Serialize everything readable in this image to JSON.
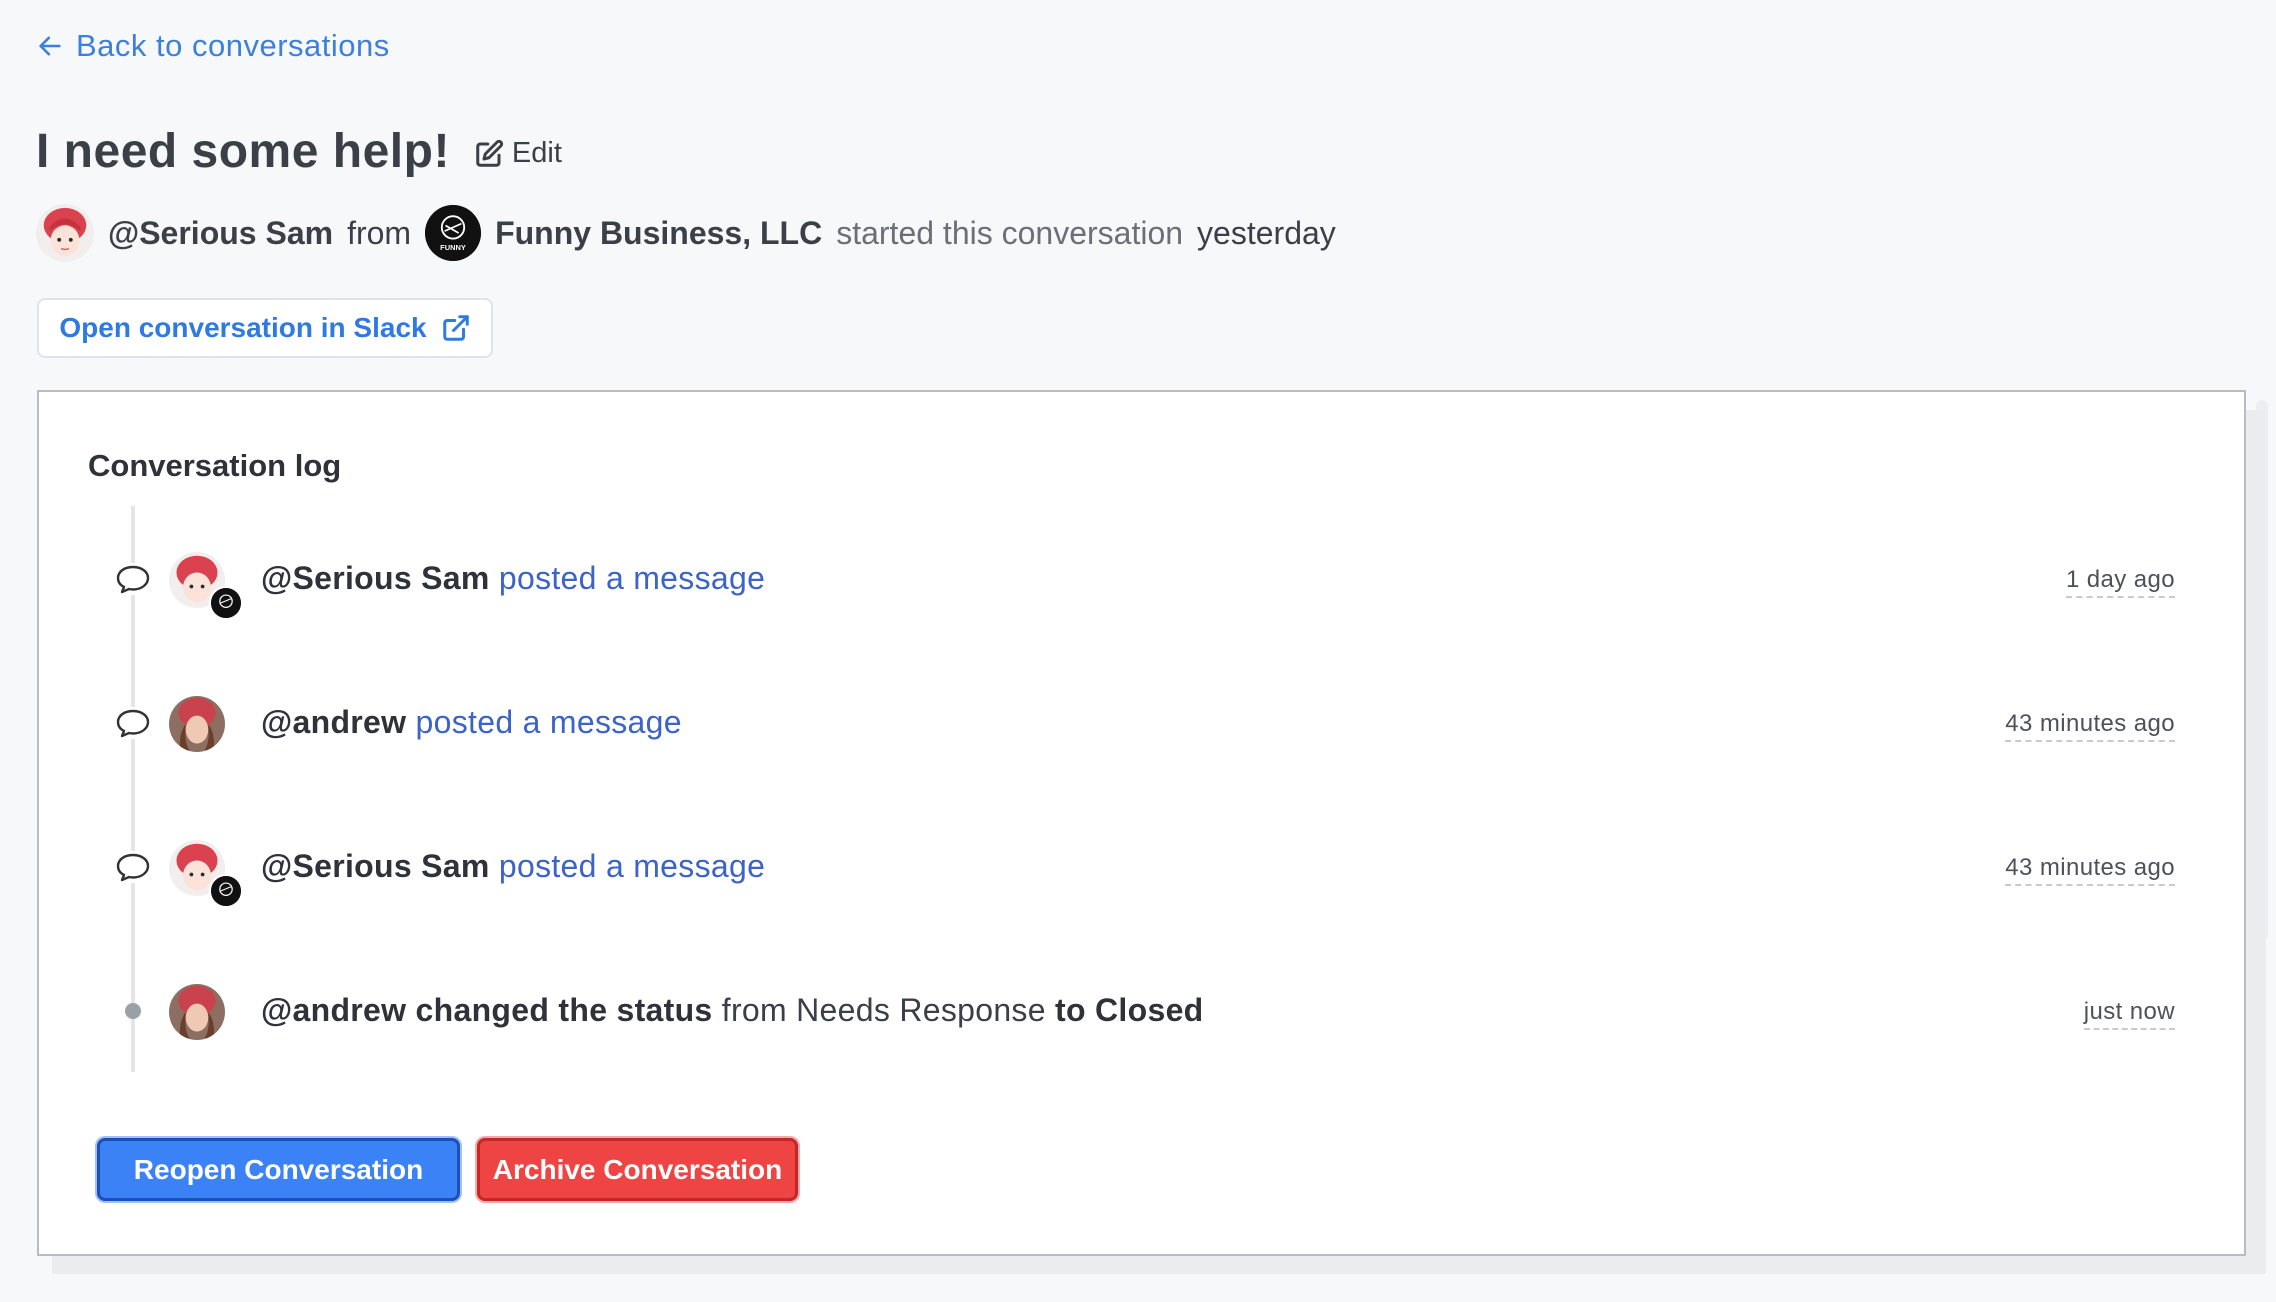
{
  "nav": {
    "back_label": "Back to conversations"
  },
  "conversation": {
    "title": "I need some help!",
    "edit_label": "Edit",
    "author": "@Serious Sam",
    "from_word": "from",
    "organization": "Funny Business, LLC",
    "started_text": "started this conversation",
    "started_when": "yesterday",
    "org_logo_text": "FUNNY"
  },
  "slack_button": {
    "label": "Open conversation in Slack"
  },
  "log": {
    "title": "Conversation log",
    "items": [
      {
        "actor": "@Serious Sam",
        "action": "posted a message",
        "time": "1 day ago",
        "kind": "message",
        "avatar": "sam"
      },
      {
        "actor": "@andrew",
        "action": "posted a message",
        "time": "43 minutes ago",
        "kind": "message",
        "avatar": "andrew"
      },
      {
        "actor": "@Serious Sam",
        "action": "posted a message",
        "time": "43 minutes ago",
        "kind": "message",
        "avatar": "sam"
      },
      {
        "actor": "@andrew changed the status",
        "from_text": "from Needs Response",
        "to_text": "to Closed",
        "time": "just now",
        "kind": "status",
        "avatar": "andrew"
      }
    ]
  },
  "actions": {
    "reopen_label": "Reopen Conversation",
    "archive_label": "Archive Conversation"
  },
  "colors": {
    "link": "#3d7fdc",
    "action_text": "#3d63c8",
    "primary": "#3b82f6",
    "danger": "#ef4444"
  },
  "icons": [
    "arrow-left-icon",
    "edit-icon",
    "external-link-icon",
    "chat-bubble-icon",
    "status-dot-icon"
  ]
}
